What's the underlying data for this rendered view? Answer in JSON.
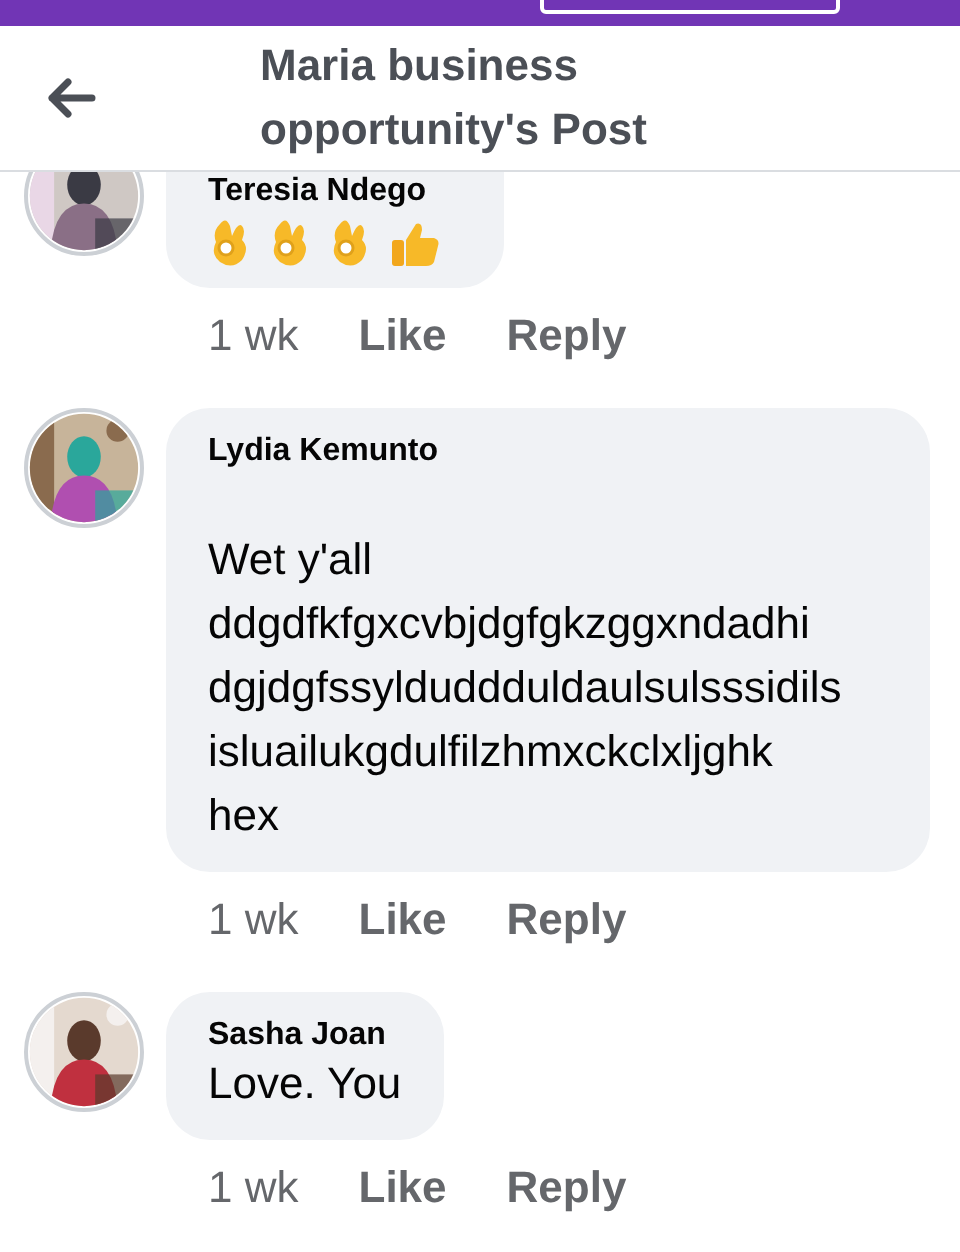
{
  "header": {
    "title": "Maria business opportunity's Post"
  },
  "comments": [
    {
      "author": "Teresia Ndego",
      "reactions": [
        {
          "kind": "ok_hand"
        },
        {
          "kind": "ok_hand"
        },
        {
          "kind": "ok_hand"
        },
        {
          "kind": "thumbs_up"
        }
      ],
      "time": "1 wk",
      "like": "Like",
      "reply": "Reply"
    },
    {
      "author": "Lydia Kemunto",
      "text": "Wet y'all\nddgdfkfgxcvbjdgfgkzggxndadhi\ndgjdgfssylduddduldaulsulsssidils\nisluailukgdulfilzhmxckclxljghk\nhex",
      "time": "1 wk",
      "like": "Like",
      "reply": "Reply"
    },
    {
      "author": "Sasha Joan",
      "text": "Love.  You",
      "time": "1 wk",
      "like": "Like",
      "reply": "Reply"
    }
  ]
}
